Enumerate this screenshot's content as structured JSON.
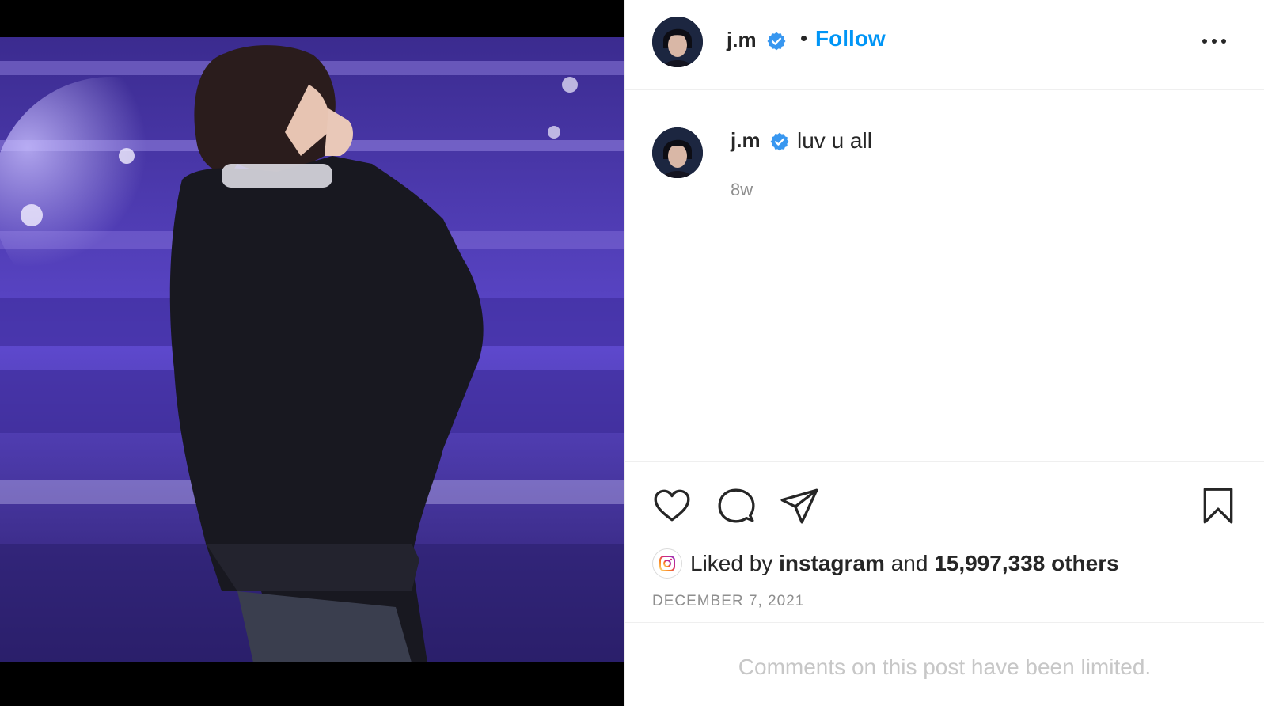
{
  "post": {
    "image_alt": "photo-of-performer-blowing-kiss-in-purple-lit-stadium"
  },
  "header": {
    "username": "j.m",
    "separator": "•",
    "follow_label": "Follow",
    "more_icon": "more-horizontal-icon"
  },
  "caption": {
    "username": "j.m",
    "text": "luv u all",
    "time_ago": "8w"
  },
  "actions": {
    "like_icon": "heart-icon",
    "comment_icon": "comment-icon",
    "share_icon": "paper-plane-icon",
    "save_icon": "bookmark-icon"
  },
  "likes": {
    "prefix": "Liked by",
    "first_user": "instagram",
    "joiner": "and",
    "others": "15,997,338 others"
  },
  "date": "DECEMBER 7, 2021",
  "comments_notice": "Comments on this post have been limited.",
  "colors": {
    "accent_blue": "#0095f6",
    "verified_blue": "#3897f0",
    "muted_text": "#8e8e8e",
    "stage_purple": "#5a45c8"
  }
}
